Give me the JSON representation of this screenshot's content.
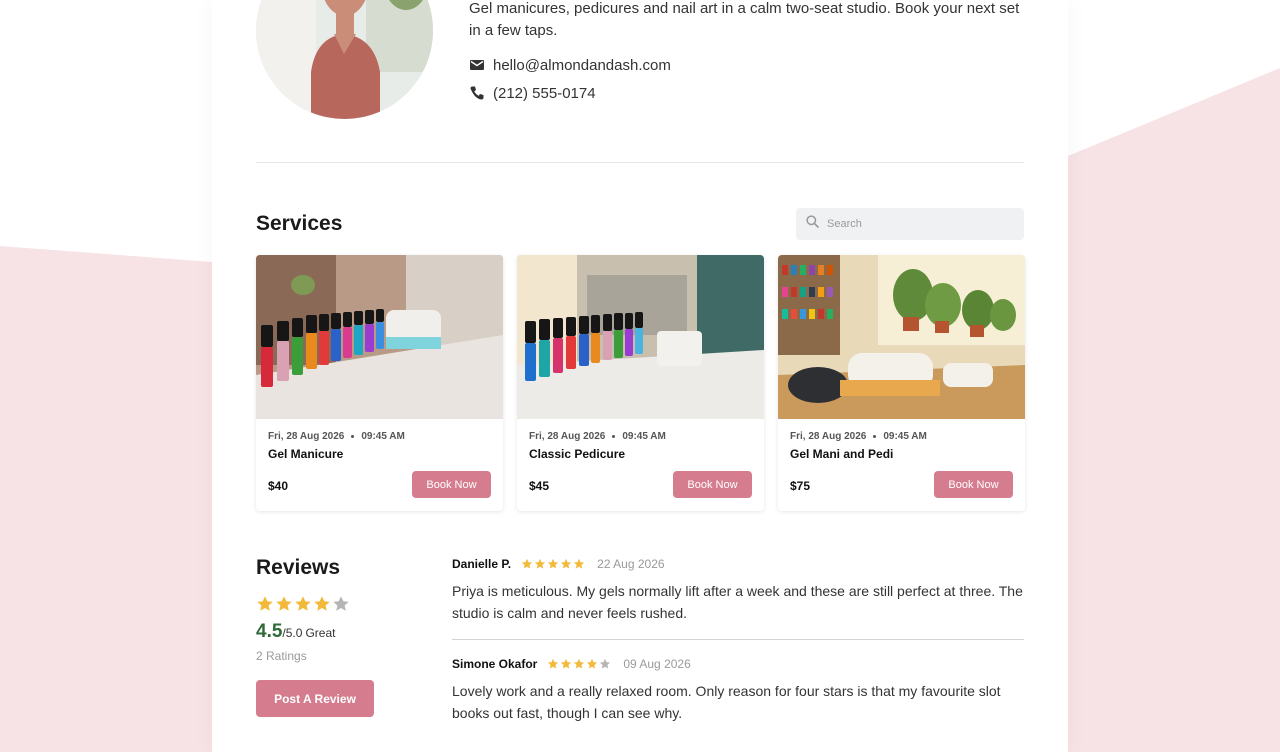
{
  "profile": {
    "bio": "Gel manicures, pedicures and nail art in a calm two-seat studio. Book your next set in a few taps.",
    "email": "hello@almondandash.com",
    "phone": "(212) 555-0174"
  },
  "services": {
    "title": "Services",
    "search_placeholder": "Search",
    "items": [
      {
        "date": "Fri, 28 Aug 2026",
        "time": "09:45 AM",
        "name": "Gel Manicure",
        "price": "$40",
        "button": "Book Now"
      },
      {
        "date": "Fri, 28 Aug 2026",
        "time": "09:45 AM",
        "name": "Classic Pedicure",
        "price": "$45",
        "button": "Book Now"
      },
      {
        "date": "Fri, 28 Aug 2026",
        "time": "09:45 AM",
        "name": "Gel Mani and Pedi",
        "price": "$75",
        "button": "Book Now"
      }
    ]
  },
  "reviews": {
    "title": "Reviews",
    "average_stars": 4.5,
    "score": "4.5",
    "score_suffix": "/5.0",
    "score_word": "Great",
    "count": "2 Ratings",
    "post_button": "Post A Review",
    "items": [
      {
        "author": "Danielle P.",
        "stars": 5,
        "date": "22 Aug 2026",
        "text": "Priya is meticulous. My gels normally lift after a week and these are still perfect at three. The studio is calm and never feels rushed."
      },
      {
        "author": "Simone Okafor",
        "stars": 4,
        "date": "09 Aug 2026",
        "text": "Lovely work and a really relaxed room. Only reason for four stars is that my favourite slot books out fast, though I can see why."
      }
    ]
  },
  "colors": {
    "accent": "#d57d8f",
    "star_filled": "#f2b93b",
    "star_empty": "#b5b5b5",
    "score_green": "#2f6b3a",
    "background_pink": "#f7e3e5"
  },
  "icons": {
    "email": "envelope-icon",
    "phone": "phone-icon",
    "search": "search-icon",
    "star": "star-icon"
  }
}
